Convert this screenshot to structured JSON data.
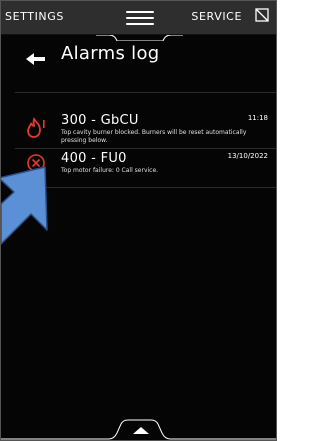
{
  "colors": {
    "background": "#050505",
    "top_bar": "#2e2e2e",
    "text": "#ffffff",
    "alarm_red": "#e23b2e",
    "pointer_blue": "#5b8fd6"
  },
  "top_bar": {
    "left_label": "SETTINGS",
    "right_label": "SERVICE",
    "menu_icon": "hamburger-icon",
    "service_icon": "wrench-square-icon"
  },
  "header": {
    "title": "Alarms log",
    "back_icon": "back-arrow-icon"
  },
  "alarms": [
    {
      "code": "300 - GbCU",
      "time": "11:18",
      "description": "Top cavity burner blocked. Burners will be reset automatically pressing below.",
      "icon": "flame-icon"
    },
    {
      "code": "400 - FU0",
      "time": "13/10/2022",
      "description": "Top motor failure: 0 Call service.",
      "icon": "error-circle-icon"
    }
  ],
  "bottom_bar": {
    "icon": "chevron-up-icon"
  },
  "overlay": {
    "icon": "pointer-arrow-icon"
  }
}
